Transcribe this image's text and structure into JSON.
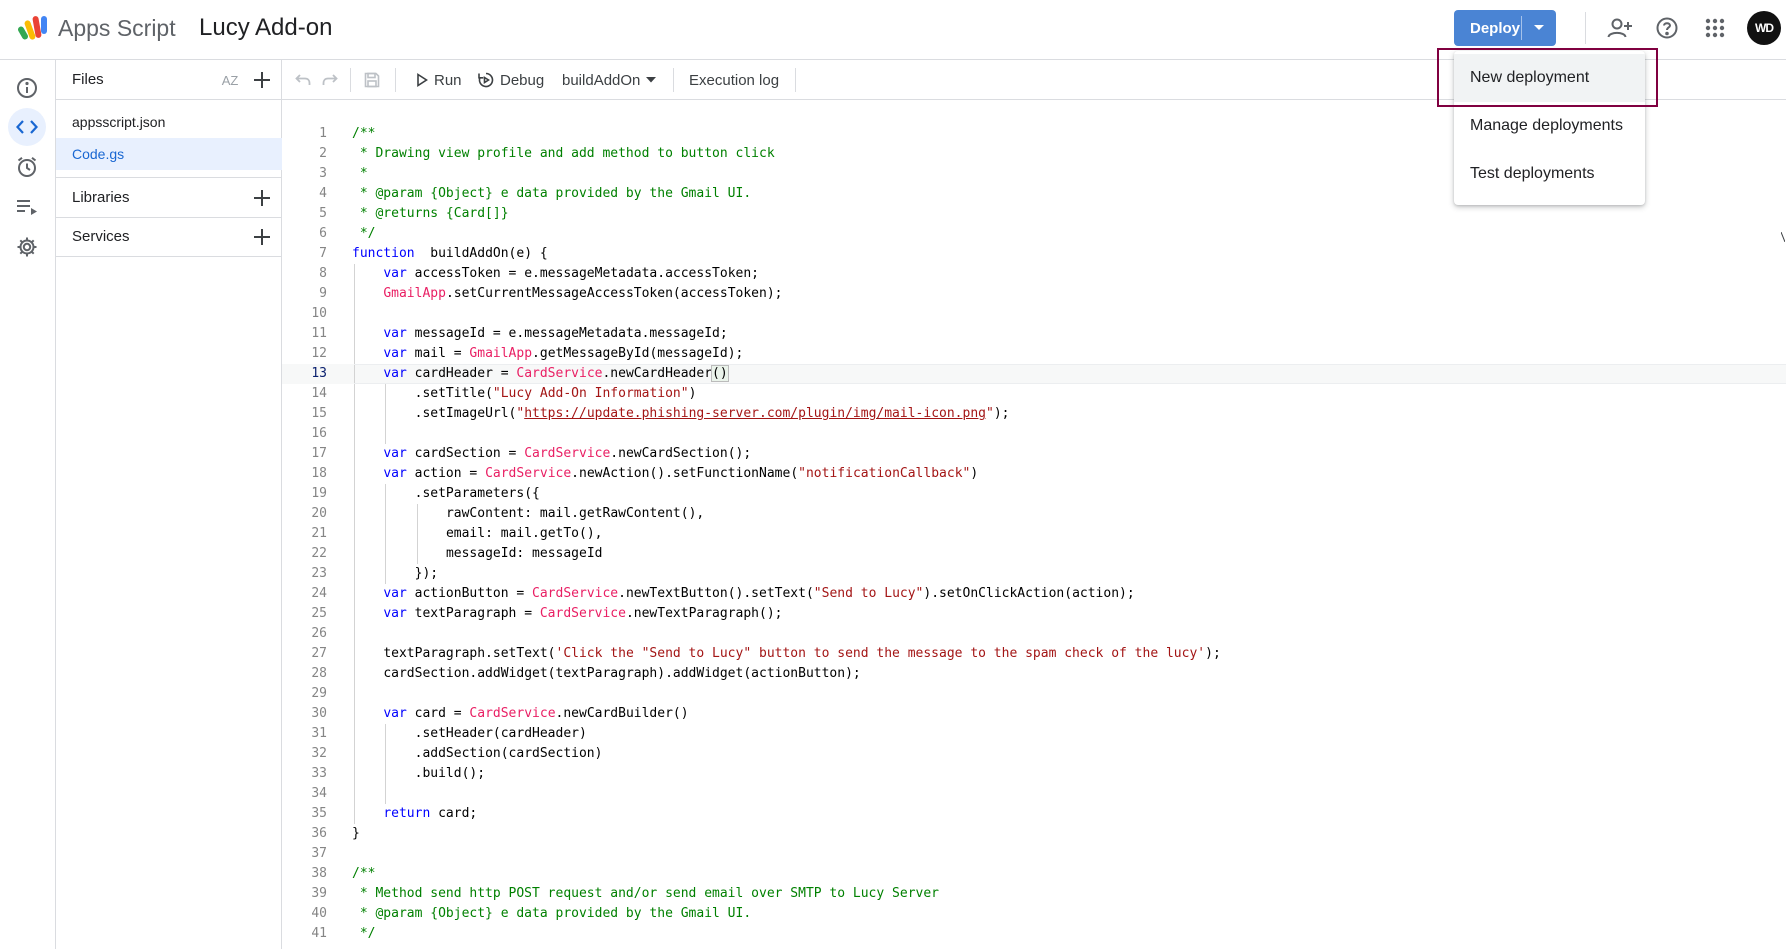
{
  "header": {
    "app_name": "Apps Script",
    "project_title": "Lucy Add-on",
    "deploy_label": "Deploy",
    "avatar_text": "WD"
  },
  "sidebar": {
    "icons": [
      "info-icon",
      "code-icon",
      "clock-icon",
      "executions-icon",
      "settings-icon"
    ],
    "active": "code-icon"
  },
  "files_panel": {
    "title": "Files",
    "sort_label": "AZ",
    "files": [
      {
        "name": "appsscript.json",
        "active": false
      },
      {
        "name": "Code.gs",
        "active": true
      }
    ],
    "libraries_label": "Libraries",
    "services_label": "Services"
  },
  "toolbar": {
    "run_label": "Run",
    "debug_label": "Debug",
    "function_select": "buildAddOn",
    "execution_log_label": "Execution log"
  },
  "deploy_menu": {
    "items": [
      "New deployment",
      "Manage deployments",
      "Test deployments"
    ],
    "highlighted": "New deployment"
  },
  "editor": {
    "current_line": 13,
    "lines": [
      {
        "n": "1",
        "indent": 0,
        "tokens": [
          [
            "c",
            "/**"
          ]
        ]
      },
      {
        "n": "2",
        "indent": 0,
        "tokens": [
          [
            "c",
            " * Drawing view profile and add method to button click"
          ]
        ]
      },
      {
        "n": "3",
        "indent": 0,
        "tokens": [
          [
            "c",
            " *"
          ]
        ]
      },
      {
        "n": "4",
        "indent": 0,
        "tokens": [
          [
            "c",
            " * @param {Object} e data provided by the Gmail UI."
          ]
        ]
      },
      {
        "n": "5",
        "indent": 0,
        "tokens": [
          [
            "c",
            " * @returns {Card[]}"
          ]
        ]
      },
      {
        "n": "6",
        "indent": 0,
        "tokens": [
          [
            "c",
            " */"
          ]
        ]
      },
      {
        "n": "7",
        "indent": 0,
        "tokens": [
          [
            "k",
            "function"
          ],
          [
            "",
            "  buildAddOn(e) {"
          ]
        ]
      },
      {
        "n": "8",
        "indent": 1,
        "tokens": [
          [
            "k",
            "var"
          ],
          [
            "",
            " accessToken = e.messageMetadata.accessToken;"
          ]
        ]
      },
      {
        "n": "9",
        "indent": 1,
        "tokens": [
          [
            "cls",
            "GmailApp"
          ],
          [
            "",
            ".setCurrentMessageAccessToken(accessToken);"
          ]
        ]
      },
      {
        "n": "10",
        "indent": 1,
        "tokens": []
      },
      {
        "n": "11",
        "indent": 1,
        "tokens": [
          [
            "k",
            "var"
          ],
          [
            "",
            " messageId = e.messageMetadata.messageId;"
          ]
        ]
      },
      {
        "n": "12",
        "indent": 1,
        "tokens": [
          [
            "k",
            "var"
          ],
          [
            "",
            " mail = "
          ],
          [
            "cls",
            "GmailApp"
          ],
          [
            "",
            ".getMessageById(messageId);"
          ]
        ]
      },
      {
        "n": "13",
        "indent": 1,
        "tokens": [
          [
            "k",
            "var"
          ],
          [
            "",
            " cardHeader = "
          ],
          [
            "cls",
            "CardService"
          ],
          [
            "",
            ".newCardHeader"
          ],
          [
            "br",
            "()"
          ]
        ]
      },
      {
        "n": "14",
        "indent": 2,
        "tokens": [
          [
            "",
            ".setTitle("
          ],
          [
            "s",
            "\"Lucy Add-On Information\""
          ],
          [
            "",
            ")"
          ]
        ]
      },
      {
        "n": "15",
        "indent": 2,
        "tokens": [
          [
            "",
            ".setImageUrl("
          ],
          [
            "s",
            "\""
          ],
          [
            "su",
            "https://update.phishing-server.com/plugin/img/mail-icon.png"
          ],
          [
            "s",
            "\""
          ],
          [
            "",
            ");"
          ]
        ]
      },
      {
        "n": "16",
        "indent": 2,
        "tokens": []
      },
      {
        "n": "17",
        "indent": 1,
        "tokens": [
          [
            "k",
            "var"
          ],
          [
            "",
            " cardSection = "
          ],
          [
            "cls",
            "CardService"
          ],
          [
            "",
            ".newCardSection();"
          ]
        ]
      },
      {
        "n": "18",
        "indent": 1,
        "tokens": [
          [
            "k",
            "var"
          ],
          [
            "",
            " action = "
          ],
          [
            "cls",
            "CardService"
          ],
          [
            "",
            ".newAction().setFunctionName("
          ],
          [
            "s",
            "\"notificationCallback\""
          ],
          [
            "",
            ")"
          ]
        ]
      },
      {
        "n": "19",
        "indent": 2,
        "tokens": [
          [
            "",
            ".setParameters({"
          ]
        ]
      },
      {
        "n": "20",
        "indent": 3,
        "tokens": [
          [
            "",
            "rawContent: mail.getRawContent(),"
          ]
        ]
      },
      {
        "n": "21",
        "indent": 3,
        "tokens": [
          [
            "",
            "email: mail.getTo(),"
          ]
        ]
      },
      {
        "n": "22",
        "indent": 3,
        "tokens": [
          [
            "",
            "messageId: messageId"
          ]
        ]
      },
      {
        "n": "23",
        "indent": 2,
        "tokens": [
          [
            "",
            "});"
          ]
        ]
      },
      {
        "n": "24",
        "indent": 1,
        "tokens": [
          [
            "k",
            "var"
          ],
          [
            "",
            " actionButton = "
          ],
          [
            "cls",
            "CardService"
          ],
          [
            "",
            ".newTextButton().setText("
          ],
          [
            "s",
            "\"Send to Lucy\""
          ],
          [
            "",
            ").setOnClickAction(action);"
          ]
        ]
      },
      {
        "n": "25",
        "indent": 1,
        "tokens": [
          [
            "k",
            "var"
          ],
          [
            "",
            " textParagraph = "
          ],
          [
            "cls",
            "CardService"
          ],
          [
            "",
            ".newTextParagraph();"
          ]
        ]
      },
      {
        "n": "26",
        "indent": 1,
        "tokens": []
      },
      {
        "n": "27",
        "indent": 1,
        "tokens": [
          [
            "",
            "textParagraph.setText("
          ],
          [
            "s",
            "'Click the \"Send to Lucy\" button to send the message to the spam check of the lucy'"
          ],
          [
            "",
            ");"
          ]
        ]
      },
      {
        "n": "28",
        "indent": 1,
        "tokens": [
          [
            "",
            "cardSection.addWidget(textParagraph).addWidget(actionButton);"
          ]
        ]
      },
      {
        "n": "29",
        "indent": 1,
        "tokens": []
      },
      {
        "n": "30",
        "indent": 1,
        "tokens": [
          [
            "k",
            "var"
          ],
          [
            "",
            " card = "
          ],
          [
            "cls",
            "CardService"
          ],
          [
            "",
            ".newCardBuilder()"
          ]
        ]
      },
      {
        "n": "31",
        "indent": 2,
        "tokens": [
          [
            "",
            ".setHeader(cardHeader)"
          ]
        ]
      },
      {
        "n": "32",
        "indent": 2,
        "tokens": [
          [
            "",
            ".addSection(cardSection)"
          ]
        ]
      },
      {
        "n": "33",
        "indent": 2,
        "tokens": [
          [
            "",
            ".build();"
          ]
        ]
      },
      {
        "n": "34",
        "indent": 2,
        "tokens": []
      },
      {
        "n": "35",
        "indent": 1,
        "tokens": [
          [
            "k",
            "return"
          ],
          [
            "",
            " card;"
          ]
        ]
      },
      {
        "n": "36",
        "indent": 0,
        "tokens": [
          [
            "",
            "}"
          ]
        ]
      },
      {
        "n": "37",
        "indent": 0,
        "tokens": []
      },
      {
        "n": "38",
        "indent": 0,
        "tokens": [
          [
            "c",
            "/**"
          ]
        ]
      },
      {
        "n": "39",
        "indent": 0,
        "tokens": [
          [
            "c",
            " * Method send http POST request and/or send email over SMTP to Lucy Server"
          ]
        ]
      },
      {
        "n": "40",
        "indent": 0,
        "tokens": [
          [
            "c",
            " * @param {Object} e data provided by the Gmail UI."
          ]
        ]
      },
      {
        "n": "41",
        "indent": 0,
        "tokens": [
          [
            "c",
            " */"
          ]
        ]
      }
    ]
  }
}
